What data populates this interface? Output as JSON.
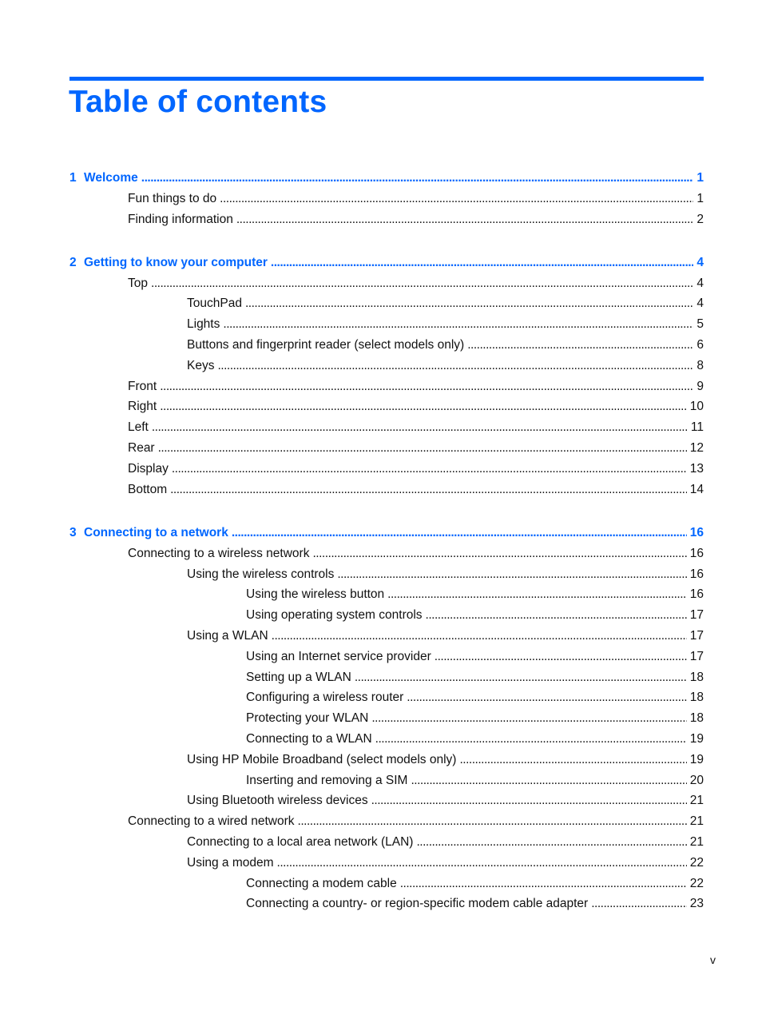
{
  "title": "Table of contents",
  "accent_color": "#0066ff",
  "page_folio": "v",
  "toc": [
    {
      "level": 0,
      "num": "1",
      "label": "Welcome",
      "page": "1"
    },
    {
      "level": 1,
      "label": "Fun things to do",
      "page": "1"
    },
    {
      "level": 1,
      "label": "Finding information",
      "page": "2"
    },
    {
      "level": 0,
      "num": "2",
      "label": "Getting to know your computer",
      "page": "4"
    },
    {
      "level": 1,
      "label": "Top",
      "page": "4"
    },
    {
      "level": 2,
      "label": "TouchPad",
      "page": "4"
    },
    {
      "level": 2,
      "label": "Lights",
      "page": "5"
    },
    {
      "level": 2,
      "label": "Buttons and fingerprint reader (select models only)",
      "page": "6"
    },
    {
      "level": 2,
      "label": "Keys",
      "page": "8"
    },
    {
      "level": 1,
      "label": "Front",
      "page": "9"
    },
    {
      "level": 1,
      "label": "Right",
      "page": "10"
    },
    {
      "level": 1,
      "label": "Left",
      "page": "11"
    },
    {
      "level": 1,
      "label": "Rear",
      "page": "12"
    },
    {
      "level": 1,
      "label": "Display",
      "page": "13"
    },
    {
      "level": 1,
      "label": "Bottom",
      "page": "14"
    },
    {
      "level": 0,
      "num": "3",
      "label": "Connecting to a network",
      "page": "16"
    },
    {
      "level": 1,
      "label": "Connecting to a wireless network",
      "page": "16"
    },
    {
      "level": 2,
      "label": "Using the wireless controls",
      "page": "16"
    },
    {
      "level": 3,
      "label": "Using the wireless button",
      "page": "16"
    },
    {
      "level": 3,
      "label": "Using operating system controls",
      "page": "17"
    },
    {
      "level": 2,
      "label": "Using a WLAN",
      "page": "17"
    },
    {
      "level": 3,
      "label": "Using an Internet service provider",
      "page": "17"
    },
    {
      "level": 3,
      "label": "Setting up a WLAN",
      "page": "18"
    },
    {
      "level": 3,
      "label": "Configuring a wireless router",
      "page": "18"
    },
    {
      "level": 3,
      "label": "Protecting your WLAN",
      "page": "18"
    },
    {
      "level": 3,
      "label": "Connecting to a WLAN",
      "page": "19"
    },
    {
      "level": 2,
      "label": "Using HP Mobile Broadband (select models only)",
      "page": "19"
    },
    {
      "level": 3,
      "label": "Inserting and removing a SIM",
      "page": "20"
    },
    {
      "level": 2,
      "label": "Using Bluetooth wireless devices",
      "page": "21"
    },
    {
      "level": 1,
      "label": "Connecting to a wired network",
      "page": "21"
    },
    {
      "level": 2,
      "label": "Connecting to a local area network (LAN)",
      "page": "21"
    },
    {
      "level": 2,
      "label": "Using a modem",
      "page": "22"
    },
    {
      "level": 3,
      "label": "Connecting a modem cable",
      "page": "22"
    },
    {
      "level": 3,
      "label": "Connecting a country- or region-specific modem cable adapter",
      "page": "23"
    }
  ]
}
